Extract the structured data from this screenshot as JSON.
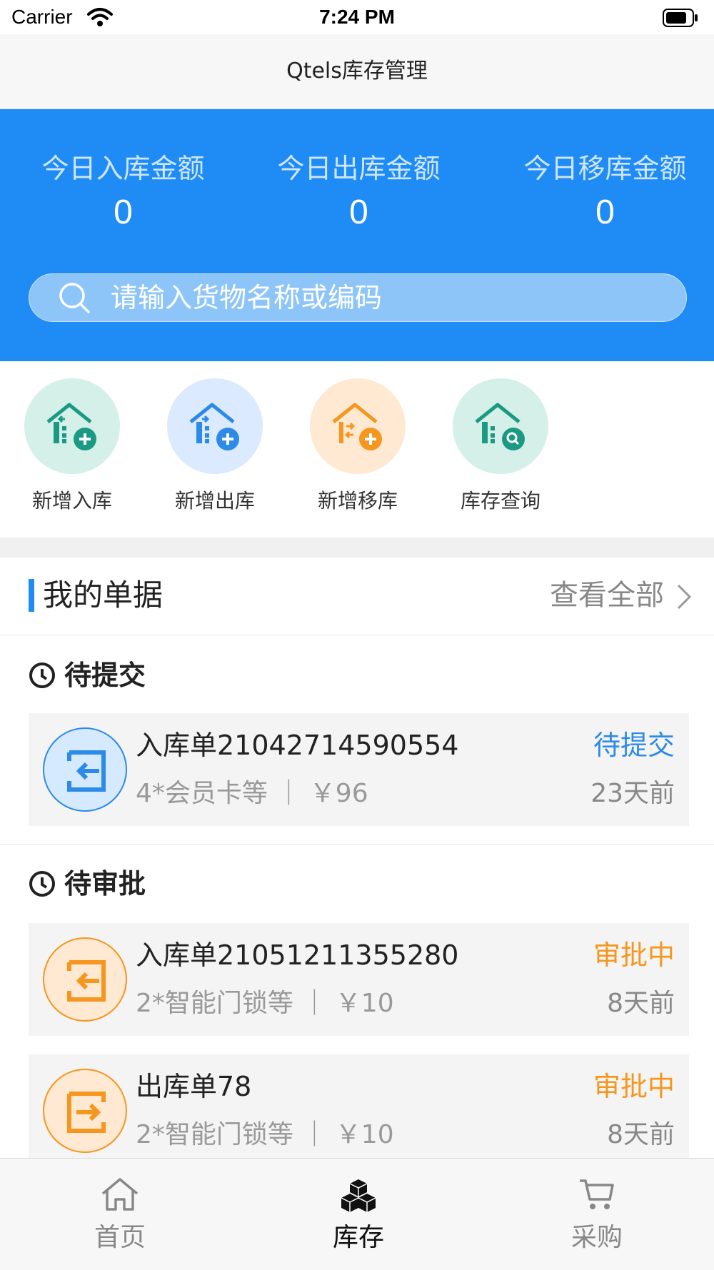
{
  "status_bar": {
    "carrier": "Carrier",
    "time": "7:24 PM"
  },
  "nav": {
    "title": "Qtels库存管理"
  },
  "stats": [
    {
      "label": "今日入库金额",
      "value": "0"
    },
    {
      "label": "今日出库金额",
      "value": "0"
    },
    {
      "label": "今日移库金额",
      "value": "0"
    }
  ],
  "search": {
    "placeholder": "请输入货物名称或编码"
  },
  "actions": [
    {
      "label": "新增入库",
      "icon": "warehouse-in-icon",
      "bg": "#d5efe9",
      "color": "#1a9a82"
    },
    {
      "label": "新增出库",
      "icon": "warehouse-out-icon",
      "bg": "#dbeafe",
      "color": "#2c8ae8"
    },
    {
      "label": "新增移库",
      "icon": "warehouse-move-icon",
      "bg": "#ffe9d2",
      "color": "#f5961f"
    },
    {
      "label": "库存查询",
      "icon": "warehouse-search-icon",
      "bg": "#d5efe9",
      "color": "#1a9a82"
    }
  ],
  "bills": {
    "title": "我的单据",
    "view_all": "查看全部",
    "groups": [
      {
        "heading": "待提交",
        "items": [
          {
            "title": "入库单21042714590554",
            "summary": "4*会员卡等 ｜ ￥96",
            "status": "待提交",
            "time": "23天前",
            "status_color": "#2c8ae8",
            "icon": "inbound-icon"
          }
        ]
      },
      {
        "heading": "待审批",
        "items": [
          {
            "title": "入库单21051211355280",
            "summary": "2*智能门锁等 ｜ ￥10",
            "status": "审批中",
            "time": "8天前",
            "status_color": "#f5961f",
            "icon": "inbound-icon"
          },
          {
            "title": "出库单78",
            "summary": "2*智能门锁等 ｜ ￥10",
            "status": "审批中",
            "time": "8天前",
            "status_color": "#f5961f",
            "icon": "outbound-icon"
          }
        ]
      }
    ]
  },
  "tabs": [
    {
      "label": "首页",
      "icon": "home-icon",
      "active": false
    },
    {
      "label": "库存",
      "icon": "boxes-icon",
      "active": true
    },
    {
      "label": "采购",
      "icon": "cart-icon",
      "active": false
    }
  ],
  "colors": {
    "primary": "#1f8bf5",
    "pending": "#2c8ae8",
    "approving": "#f5961f"
  }
}
